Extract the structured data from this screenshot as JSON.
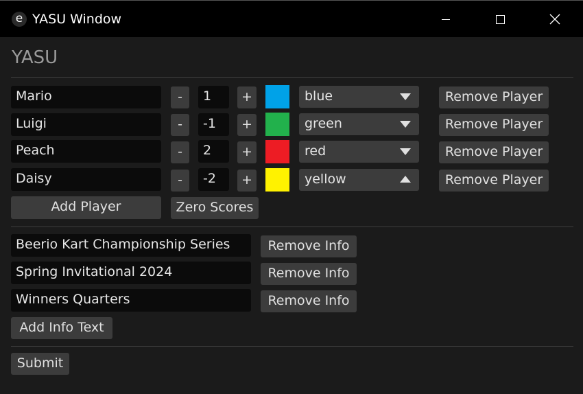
{
  "window": {
    "icon_glyph": "e",
    "title": "YASU Window",
    "controls": {
      "minimize": "minimize-icon",
      "maximize": "maximize-icon",
      "close": "close-icon"
    }
  },
  "app_title": "YASU",
  "players": [
    {
      "name": "Mario",
      "minus": "-",
      "score": "1",
      "plus": "+",
      "color_hex": "#00a2e8",
      "color_name": "blue",
      "dropdown_open": false,
      "remove": "Remove Player"
    },
    {
      "name": "Luigi",
      "minus": "-",
      "score": "-1",
      "plus": "+",
      "color_hex": "#22b14c",
      "color_name": "green",
      "dropdown_open": false,
      "remove": "Remove Player"
    },
    {
      "name": "Peach",
      "minus": "-",
      "score": "2",
      "plus": "+",
      "color_hex": "#ed1c24",
      "color_name": "red",
      "dropdown_open": false,
      "remove": "Remove Player"
    },
    {
      "name": "Daisy",
      "minus": "-",
      "score": "-2",
      "plus": "+",
      "color_hex": "#fff200",
      "color_name": "yellow",
      "dropdown_open": true,
      "remove": "Remove Player"
    }
  ],
  "add_player": "Add Player",
  "zero_scores": "Zero Scores",
  "info": [
    {
      "text": "Beerio Kart Championship Series",
      "remove": "Remove Info"
    },
    {
      "text": "Spring Invitational 2024",
      "remove": "Remove Info"
    },
    {
      "text": "Winners Quarters",
      "remove": "Remove Info"
    }
  ],
  "add_info": "Add Info Text",
  "submit": "Submit"
}
